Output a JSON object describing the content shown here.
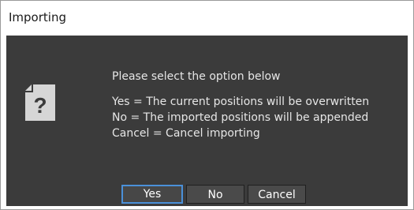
{
  "window": {
    "title": "Importing"
  },
  "message": {
    "intro": "Please select the option below",
    "yes_line": "Yes = The current positions will be overwritten",
    "no_line": "No = The imported positions will be appended",
    "cancel_line": "Cancel = Cancel importing"
  },
  "buttons": {
    "yes": "Yes",
    "no": "No",
    "cancel": "Cancel"
  },
  "icon": {
    "name": "question-document-icon",
    "glyph": "?"
  },
  "colors": {
    "body_bg": "#3b3b3b",
    "text": "#e6e6e6",
    "focus_border": "#4a90d9"
  }
}
